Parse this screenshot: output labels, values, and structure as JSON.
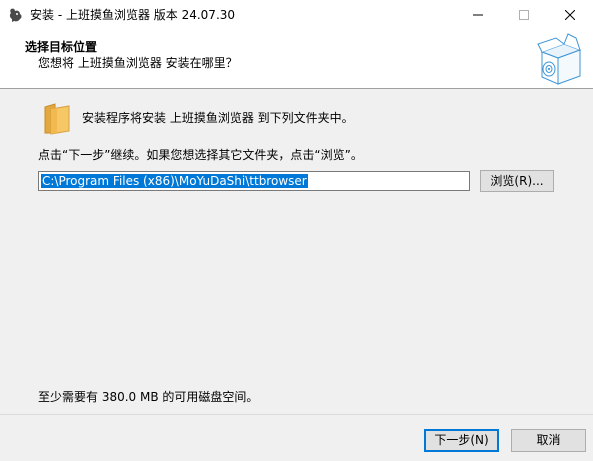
{
  "window": {
    "title": "安装 - 上班摸鱼浏览器 版本 24.07.30",
    "icon": "app-logo-icon"
  },
  "header": {
    "title": "选择目标位置",
    "subtitle": "您想将 上班摸鱼浏览器 安装在哪里？",
    "image": "install-box-icon"
  },
  "body": {
    "folder_icon": "folder-icon",
    "info": "安装程序将安装 上班摸鱼浏览器 到下列文件夹中。",
    "instruction": "点击“下一步”继续。如果您想选择其它文件夹，点击“浏览”。",
    "path_value": "C:\\Program Files (x86)\\MoYuDaShi\\ttbrowser",
    "browse_label": "浏览(R)...",
    "space_required": "至少需要有 380.0 MB 的可用磁盘空间。"
  },
  "footer": {
    "next_label": "下一步(N)",
    "cancel_label": "取消"
  },
  "colors": {
    "selection": "#0078d7",
    "default_button_border": "#0078d7",
    "folder": "#f0c060"
  }
}
